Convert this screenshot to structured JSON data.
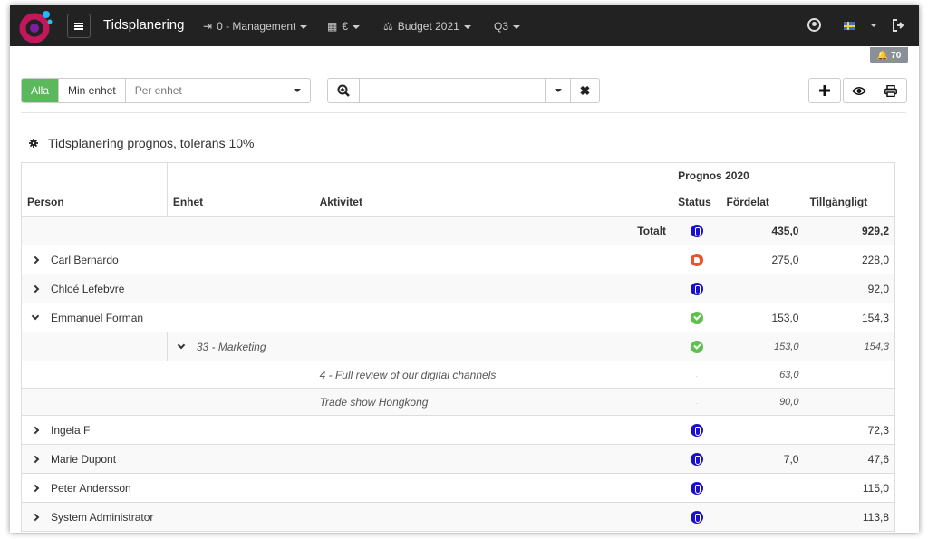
{
  "nav": {
    "title": "Tidsplanering",
    "items": [
      {
        "label": "0 - Management",
        "icon": "sign-in-icon"
      },
      {
        "label": "€",
        "icon": "calculator-icon"
      },
      {
        "label": "Budget 2021",
        "icon": "balance-scale-icon"
      },
      {
        "label": "Q3",
        "icon": ""
      }
    ],
    "notifications": "70",
    "colors": {
      "bar": "#222222",
      "logo_magenta": "#c2185b",
      "logo_blue": "#29b6f6"
    }
  },
  "filters": {
    "all_label": "Alla",
    "mine_label": "Min enhet",
    "per_unit_placeholder": "Per enhet",
    "search_value": "",
    "active_color": "#5cb85c"
  },
  "section": {
    "title": "Tidsplanering prognos, tolerans 10%"
  },
  "table": {
    "group_header": "Prognos 2020",
    "columns": [
      "Person",
      "Enhet",
      "Aktivitet",
      "Status",
      "Fördelat",
      "Tillgängligt"
    ],
    "total": {
      "label": "Totalt",
      "status": "blue",
      "allocated": "435,0",
      "available": "929,2"
    },
    "rows": [
      {
        "person": "Carl Bernardo",
        "status": "red",
        "allocated": "275,0",
        "available": "228,0"
      },
      {
        "person": "Chloé Lefebvre",
        "status": "blue",
        "allocated": "",
        "available": "92,0"
      },
      {
        "person": "Emmanuel Forman",
        "status": "green",
        "allocated": "153,0",
        "available": "154,3",
        "expanded": true
      }
    ],
    "unit_row": {
      "unit": "33 - Marketing",
      "status": "green",
      "allocated": "153,0",
      "available": "154,3"
    },
    "activities": [
      {
        "name": "4 - Full review of our digital channels",
        "allocated": "63,0"
      },
      {
        "name": "Trade show Hongkong",
        "allocated": "90,0"
      }
    ],
    "rows_after": [
      {
        "person": "Ingela F",
        "status": "blue",
        "allocated": "",
        "available": "72,3"
      },
      {
        "person": "Marie Dupont",
        "status": "blue",
        "allocated": "7,0",
        "available": "47,6"
      },
      {
        "person": "Peter Andersson",
        "status": "blue",
        "allocated": "",
        "available": "115,0"
      },
      {
        "person": "System Administrator",
        "status": "blue",
        "allocated": "",
        "available": "113,8"
      }
    ]
  }
}
